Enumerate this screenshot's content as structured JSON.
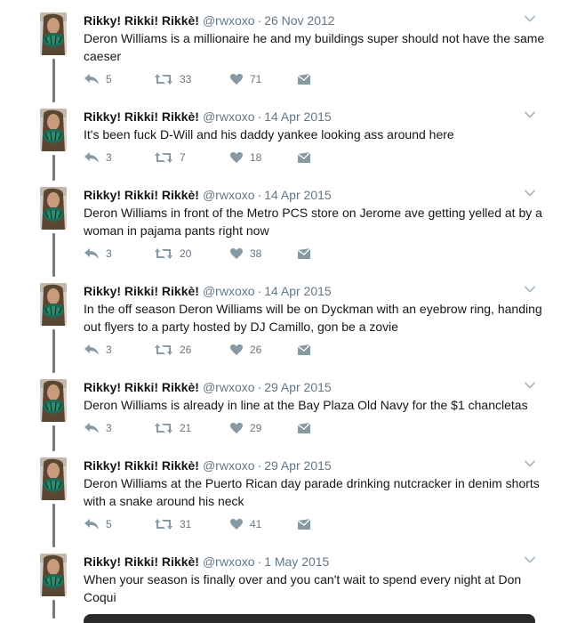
{
  "tweets": [
    {
      "name": "Rikky! Rikki! Rikkè!",
      "handle": "@rwxoxo",
      "sep": "·",
      "date": "26 Nov 2012",
      "text": "Deron Williams is a millionaire he and my buildings super should not have the same caeser",
      "replies": "5",
      "retweets": "33",
      "likes": "71"
    },
    {
      "name": "Rikky! Rikki! Rikkè!",
      "handle": "@rwxoxo",
      "sep": "·",
      "date": "14 Apr 2015",
      "text": "It's been fuck D-Will and his daddy yankee looking ass around here",
      "replies": "3",
      "retweets": "7",
      "likes": "18"
    },
    {
      "name": "Rikky! Rikki! Rikkè!",
      "handle": "@rwxoxo",
      "sep": "·",
      "date": "14 Apr 2015",
      "text": "Deron Williams in front of the Metro PCS store on Jerome ave getting yelled at by a woman in pajama pants right now",
      "replies": "3",
      "retweets": "20",
      "likes": "38"
    },
    {
      "name": "Rikky! Rikki! Rikkè!",
      "handle": "@rwxoxo",
      "sep": "·",
      "date": "14 Apr 2015",
      "text": "In the off season Deron Williams will be on Dyckman with an eyebrow ring, handing out flyers to a party hosted by DJ Camillo, gon be a zovie",
      "replies": "3",
      "retweets": "26",
      "likes": "26"
    },
    {
      "name": "Rikky! Rikki! Rikkè!",
      "handle": "@rwxoxo",
      "sep": "·",
      "date": "29 Apr 2015",
      "text": "Deron Williams is already in line at the Bay Plaza Old Navy for the $1 chancletas",
      "replies": "3",
      "retweets": "21",
      "likes": "29"
    },
    {
      "name": "Rikky! Rikki! Rikkè!",
      "handle": "@rwxoxo",
      "sep": "·",
      "date": "29 Apr 2015",
      "text": "Deron Williams at the Puerto Rican day parade drinking nutcracker in denim shorts with a snake around his neck",
      "replies": "5",
      "retweets": "31",
      "likes": "41"
    },
    {
      "name": "Rikky! Rikki! Rikkè!",
      "handle": "@rwxoxo",
      "sep": "·",
      "date": "1 May 2015",
      "text": "When your season is finally over and you can't wait to spend every night at Don Coqui",
      "replies": "",
      "retweets": "",
      "likes": ""
    }
  ],
  "icons": {
    "reply": "reply-icon",
    "retweet": "retweet-icon",
    "like": "heart-icon",
    "dm": "envelope-icon",
    "menu": "chevron-down-icon",
    "avatar": "profile-photo"
  },
  "colors": {
    "name": "#14171a",
    "meta": "#657786",
    "icon": "#8899a6",
    "thread_line": "#6f7b85"
  }
}
